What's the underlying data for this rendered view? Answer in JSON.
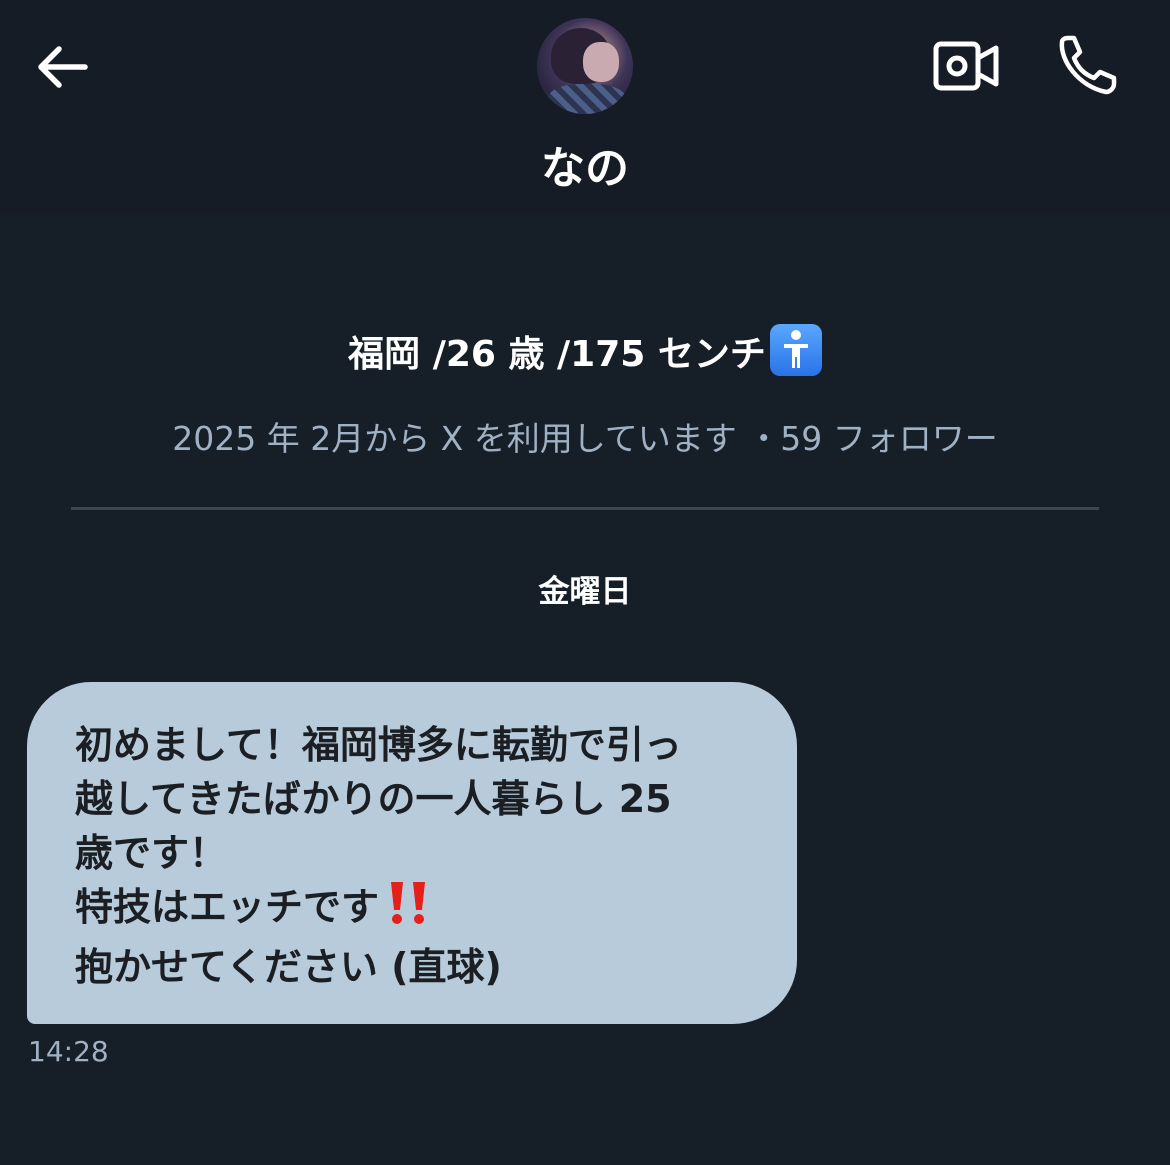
{
  "header": {
    "name": "なの"
  },
  "profile": {
    "bio": "福岡 /26 歳 /175 センチ",
    "meta": "2025 年 2月から X を利用しています ・59 フォロワー"
  },
  "conversation": {
    "day_label": "金曜日",
    "messages": [
      {
        "lines": [
          "初めまして！福岡博多に転勤で引っ",
          "越してきたばかりの一人暮らし 25",
          "歳です！",
          "特技はエッチです",
          "抱かせてください (直球)"
        ],
        "time": "14:28"
      }
    ]
  },
  "colors": {
    "background": "#161e28",
    "bubble": "#b7cbda",
    "meta_text": "#9fb1c3"
  }
}
